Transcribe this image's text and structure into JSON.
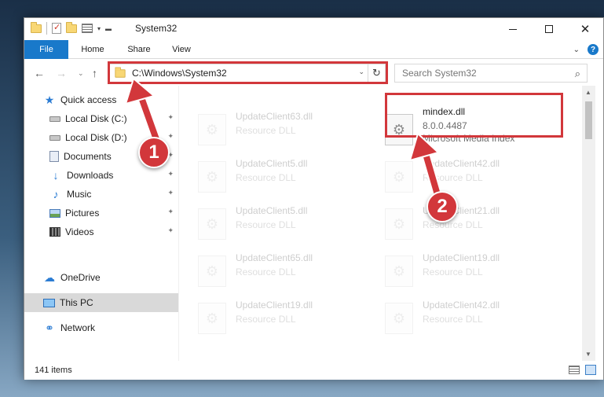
{
  "window": {
    "title": "System32",
    "minimize_glyph": "",
    "maximize_glyph": "",
    "close_glyph": "✕"
  },
  "ribbon": {
    "tabs": [
      "File",
      "Home",
      "Share",
      "View"
    ],
    "help": "?",
    "expand": "⌄"
  },
  "nav": {
    "back": "←",
    "forward": "→",
    "recent": "⌄",
    "up": "↑",
    "address": "C:\\Windows\\System32",
    "address_dropdown": "⌄",
    "refresh": "↻",
    "search_placeholder": "Search System32",
    "search_icon": "⌕"
  },
  "sidebar": {
    "items": [
      {
        "label": "Quick access",
        "icon": "star-icon",
        "glyph": "★"
      },
      {
        "label": "Local Disk (C:)",
        "icon": "disk-icon",
        "glyph": "",
        "pinned": true
      },
      {
        "label": "Local Disk (D:)",
        "icon": "disk-icon",
        "glyph": "",
        "pinned": true
      },
      {
        "label": "Documents",
        "icon": "document-icon",
        "glyph": "",
        "pinned": true
      },
      {
        "label": "Downloads",
        "icon": "download-icon",
        "glyph": "↓",
        "pinned": true
      },
      {
        "label": "Music",
        "icon": "music-icon",
        "glyph": "♪",
        "pinned": true
      },
      {
        "label": "Pictures",
        "icon": "picture-icon",
        "glyph": "",
        "pinned": true
      },
      {
        "label": "Videos",
        "icon": "video-icon",
        "glyph": "",
        "pinned": true
      },
      {
        "label": "OneDrive",
        "icon": "cloud-icon",
        "glyph": "☁"
      },
      {
        "label": "This PC",
        "icon": "computer-icon",
        "glyph": "",
        "selected": true
      },
      {
        "label": "Network",
        "icon": "network-icon",
        "glyph": "⚭"
      }
    ],
    "pin_glyph": "📌"
  },
  "files": [
    {
      "name": "UpdateClient63.dll",
      "type": "Resource DLL"
    },
    {
      "name": "mindex.dll",
      "version": "8.0.0.4487",
      "description": "Microsoft Media Index"
    },
    {
      "name": "UpdateClient5.dll",
      "type": "Resource DLL"
    },
    {
      "name": "UpdateClient42.dll",
      "type": "Resource DLL"
    },
    {
      "name": "UpdateClient5.dll",
      "type": "Resource DLL"
    },
    {
      "name": "UpdateClient21.dll",
      "type": "Resource DLL"
    },
    {
      "name": "UpdateClient65.dll",
      "type": "Resource DLL"
    },
    {
      "name": "UpdateClient19.dll",
      "type": "Resource DLL"
    },
    {
      "name": "UpdateClient19.dll",
      "type": "Resource DLL"
    },
    {
      "name": "UpdateClient42.dll",
      "type": "Resource DLL"
    }
  ],
  "file_icon_glyph": "⚙",
  "status": {
    "item_count": "141 items"
  },
  "callouts": {
    "step1": "1",
    "step2": "2"
  },
  "colors": {
    "accent": "#1979ca",
    "highlight": "#d2373b"
  }
}
